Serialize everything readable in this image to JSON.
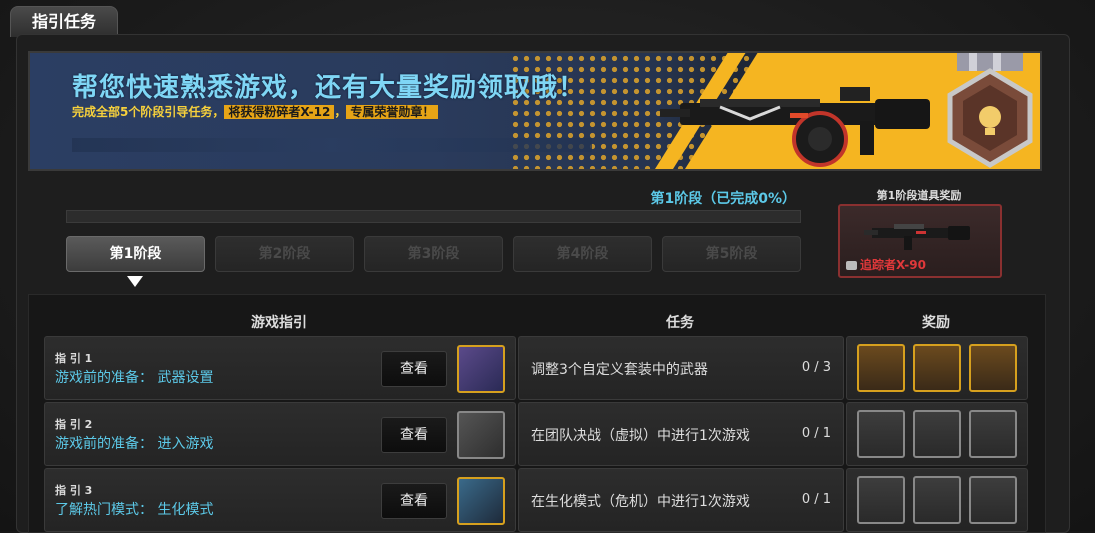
{
  "tab": {
    "title": "指引任务"
  },
  "banner": {
    "title": "帮您快速熟悉游戏，还有大量奖励领取哦！",
    "sub_prefix": "完成全部5个阶段引导任务，",
    "sub_highlight_1": "将获得粉碎者X-12",
    "sub_sep": "，",
    "sub_highlight_2": "专属荣誉勋章！"
  },
  "stage": {
    "progress_label": "第1阶段（已完成0%）",
    "progress_value": 0,
    "tabs": [
      "第1阶段",
      "第2阶段",
      "第3阶段",
      "第4阶段",
      "第5阶段"
    ],
    "active_index": 0
  },
  "stage_reward": {
    "title": "第1阶段道具奖励",
    "item_name": "追踪者X-90"
  },
  "table": {
    "headers": {
      "guide": "游戏指引",
      "task": "任务",
      "reward": "奖励"
    },
    "view_label": "查看",
    "rows": [
      {
        "num": "指 引 1",
        "title": "游戏前的准备：  武器设置",
        "task": "调整3个自定义套装中的武器",
        "count": "0 / 3",
        "reward_style": "gold"
      },
      {
        "num": "指 引 2",
        "title": "游戏前的准备：  进入游戏",
        "task": "在团队决战（虚拟）中进行1次游戏",
        "count": "0 / 1",
        "reward_style": "grey"
      },
      {
        "num": "指 引 3",
        "title": "了解热门模式：  生化模式",
        "task": "在生化模式（危机）中进行1次游戏",
        "count": "0 / 1",
        "reward_style": "grey"
      }
    ]
  },
  "colors": {
    "accent": "#5cc9e8",
    "gold": "#f5b521",
    "reward_red": "#e0383a"
  }
}
